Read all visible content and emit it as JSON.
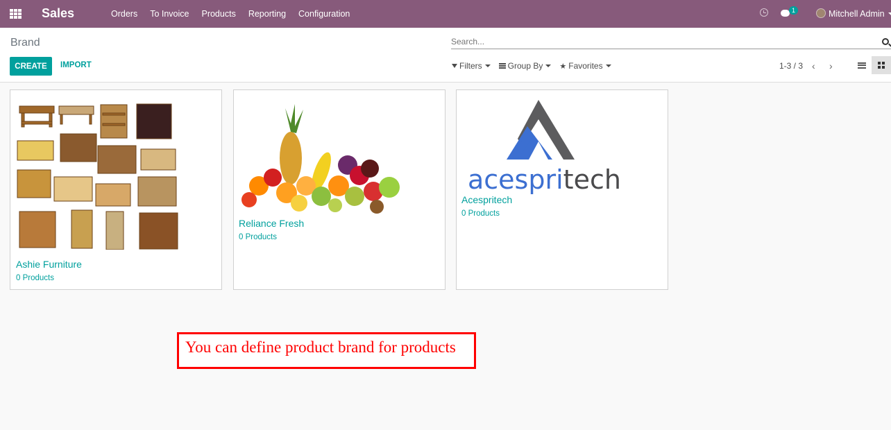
{
  "navbar": {
    "app_title": "Sales",
    "menu": [
      "Orders",
      "To Invoice",
      "Products",
      "Reporting",
      "Configuration"
    ],
    "chat_badge": "1",
    "user_name": "Mitchell Admin",
    "color": "#875a7b"
  },
  "control": {
    "breadcrumb": "Brand",
    "create_label": "CREATE",
    "import_label": "IMPORT",
    "search_placeholder": "Search...",
    "filters_label": "Filters",
    "group_by_label": "Group By",
    "favorites_label": "Favorites",
    "pager": "1-3 / 3"
  },
  "cards": [
    {
      "name": "Ashie Furniture",
      "count": "0 Products",
      "image": "furniture-collage"
    },
    {
      "name": "Reliance Fresh",
      "count": "0 Products",
      "image": "fruits-photo"
    },
    {
      "name": "Acespritech",
      "count": "0 Products",
      "image": "acespritech-logo",
      "logo_text": "acespritech"
    }
  ],
  "annotation": {
    "text": "You can define product brand for products",
    "color": "#ff0000"
  },
  "accent": "#00a09d"
}
